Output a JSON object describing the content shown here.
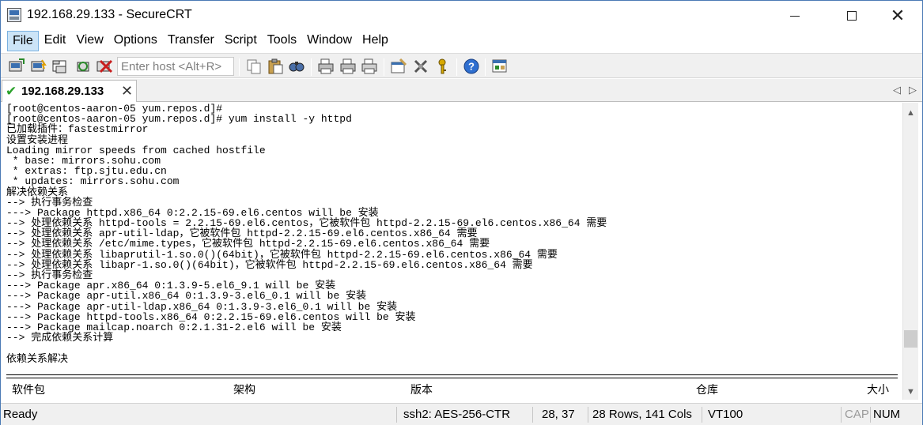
{
  "window": {
    "title": "192.168.29.133 - SecureCRT"
  },
  "menu": [
    "File",
    "Edit",
    "View",
    "Options",
    "Transfer",
    "Script",
    "Tools",
    "Window",
    "Help"
  ],
  "toolbar": {
    "host_placeholder": "Enter host <Alt+R>",
    "icons": [
      "connect-icon",
      "quick-connect-icon",
      "connect-in-tab-icon",
      "reconnect-icon",
      "disconnect-icon",
      "copy-icon",
      "paste-icon",
      "find-icon",
      "print-icon",
      "print-setup-icon",
      "print-screen-icon",
      "session-options-icon",
      "keymap-icon",
      "key-agent-icon",
      "help-icon",
      "sftp-icon"
    ]
  },
  "tab": {
    "label": "192.168.29.133",
    "status_icon": "check-icon"
  },
  "terminal": {
    "lines": [
      "[root@centos-aaron-05 yum.repos.d]#",
      "[root@centos-aaron-05 yum.repos.d]# yum install -y httpd",
      "已加载插件：fastestmirror",
      "设置安装进程",
      "Loading mirror speeds from cached hostfile",
      " * base: mirrors.sohu.com",
      " * extras: ftp.sjtu.edu.cn",
      " * updates: mirrors.sohu.com",
      "解决依赖关系",
      "--> 执行事务检查",
      "---> Package httpd.x86_64 0:2.2.15-69.el6.centos will be 安装",
      "--> 处理依赖关系 httpd-tools = 2.2.15-69.el6.centos，它被软件包 httpd-2.2.15-69.el6.centos.x86_64 需要",
      "--> 处理依赖关系 apr-util-ldap，它被软件包 httpd-2.2.15-69.el6.centos.x86_64 需要",
      "--> 处理依赖关系 /etc/mime.types，它被软件包 httpd-2.2.15-69.el6.centos.x86_64 需要",
      "--> 处理依赖关系 libaprutil-1.so.0()(64bit)，它被软件包 httpd-2.2.15-69.el6.centos.x86_64 需要",
      "--> 处理依赖关系 libapr-1.so.0()(64bit)，它被软件包 httpd-2.2.15-69.el6.centos.x86_64 需要",
      "--> 执行事务检查",
      "---> Package apr.x86_64 0:1.3.9-5.el6_9.1 will be 安装",
      "---> Package apr-util.x86_64 0:1.3.9-3.el6_0.1 will be 安装",
      "---> Package apr-util-ldap.x86_64 0:1.3.9-3.el6_0.1 will be 安装",
      "---> Package httpd-tools.x86_64 0:2.2.15-69.el6.centos will be 安装",
      "---> Package mailcap.noarch 0:2.1.31-2.el6 will be 安装",
      "--> 完成依赖关系计算",
      "",
      "依赖关系解决"
    ],
    "table_headers": [
      "软件包",
      "架构",
      "版本",
      "仓库",
      "大小"
    ]
  },
  "status": {
    "ready": "Ready",
    "cipher": "ssh2: AES-256-CTR",
    "cursor": "28,  37",
    "size": "28 Rows, 141 Cols",
    "term_type": "VT100",
    "cap": "CAP",
    "num": "NUM"
  }
}
